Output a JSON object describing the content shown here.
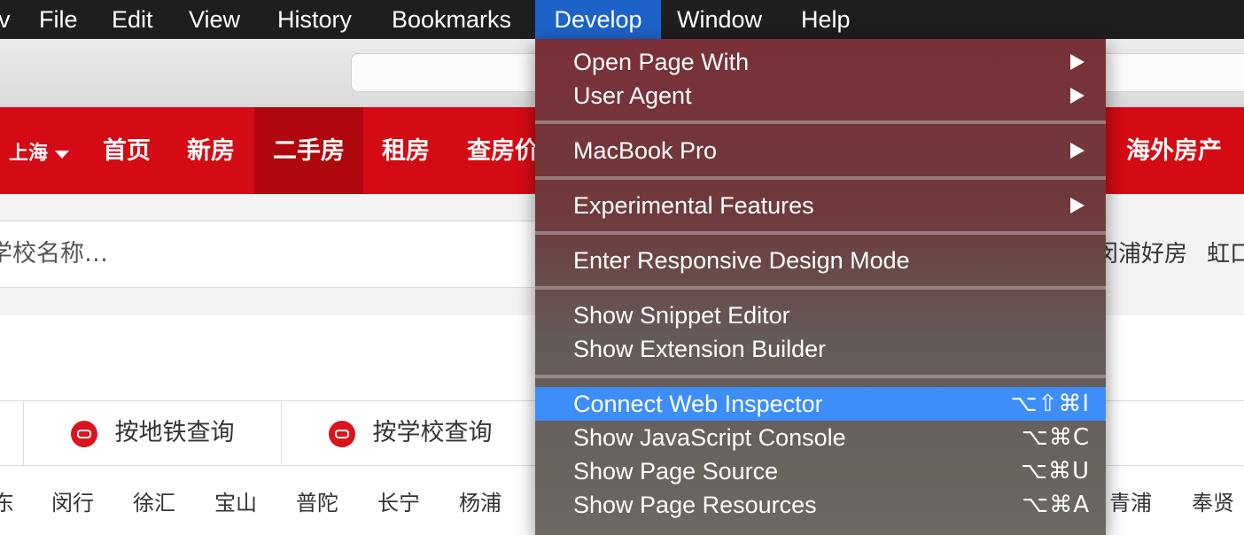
{
  "menubar": {
    "items": [
      {
        "label": "v"
      },
      {
        "label": "File"
      },
      {
        "label": "Edit"
      },
      {
        "label": "View"
      },
      {
        "label": "History"
      },
      {
        "label": "Bookmarks"
      },
      {
        "label": "Develop"
      },
      {
        "label": "Window"
      },
      {
        "label": "Help"
      }
    ],
    "active": "Develop"
  },
  "develop_menu": {
    "groups": [
      [
        {
          "label": "Open Page With",
          "submenu": true
        },
        {
          "label": "User Agent",
          "submenu": true
        }
      ],
      [
        {
          "label": "MacBook Pro",
          "submenu": true
        }
      ],
      [
        {
          "label": "Experimental Features",
          "submenu": true
        }
      ],
      [
        {
          "label": "Enter Responsive Design Mode"
        }
      ],
      [
        {
          "label": "Show Snippet Editor"
        },
        {
          "label": "Show Extension Builder"
        }
      ],
      [
        {
          "label": "Connect Web Inspector",
          "shortcut": "⌥⇧⌘I",
          "highlighted": true
        },
        {
          "label": "Show JavaScript Console",
          "shortcut": "⌥⌘C"
        },
        {
          "label": "Show Page Source",
          "shortcut": "⌥⌘U"
        },
        {
          "label": "Show Page Resources",
          "shortcut": "⌥⌘A"
        }
      ]
    ]
  },
  "site": {
    "city": "上海",
    "nav": [
      "首页",
      "新房",
      "二手房",
      "租房",
      "查房价",
      "海外房产"
    ],
    "active_nav": "二手房",
    "search_placeholder": "学校名称…",
    "hot_links": [
      "闵浦好房",
      "虹口"
    ],
    "query_tabs": [
      "按地铁查询",
      "按学校查询"
    ],
    "districts": [
      "东",
      "闵行",
      "徐汇",
      "宝山",
      "普陀",
      "长宁",
      "杨浦",
      "青浦",
      "奉贤"
    ]
  },
  "colors": {
    "menubar_bg": "#1e1e1e",
    "menubar_active": "#1d62c9",
    "site_red": "#d40a14",
    "menu_highlight": "#3d8ef8"
  }
}
